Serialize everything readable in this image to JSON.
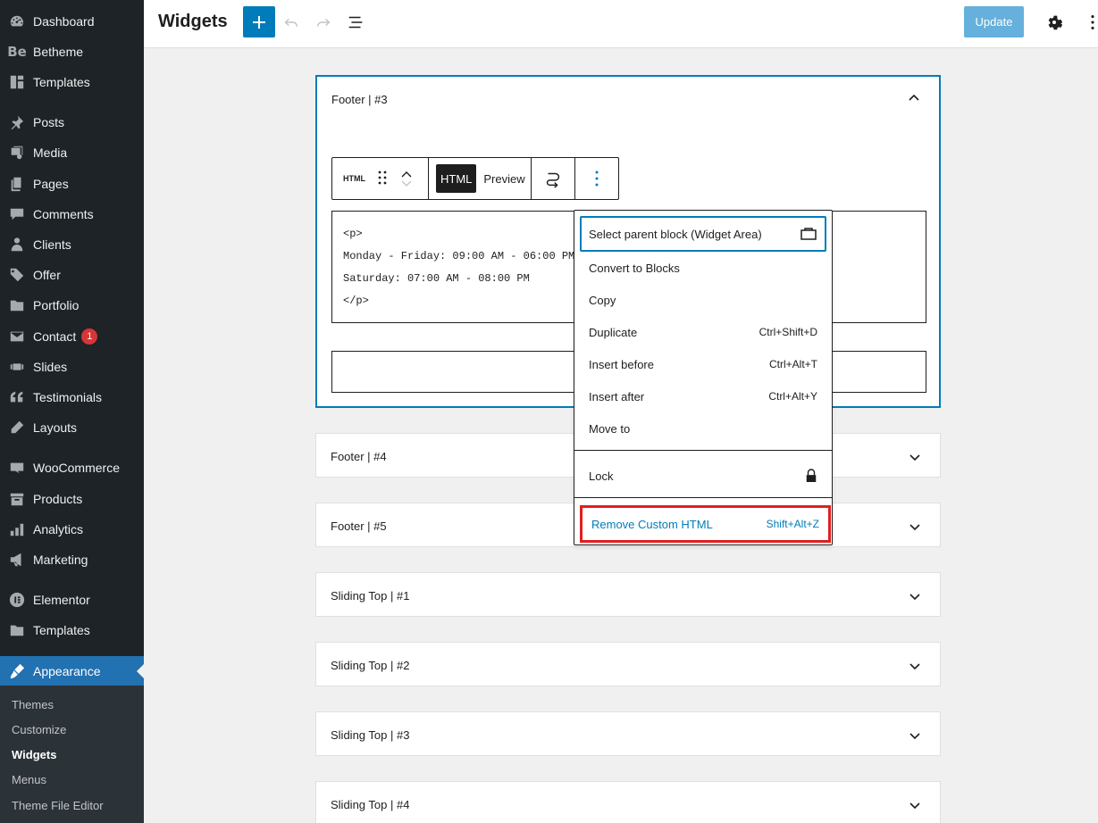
{
  "sidebar": {
    "items": [
      {
        "label": "Dashboard",
        "icon": "dashboard-icon"
      },
      {
        "label": "Betheme",
        "icon": "betheme-icon"
      },
      {
        "label": "Templates",
        "icon": "templates-icon"
      },
      {
        "label": "Posts",
        "icon": "pin-icon"
      },
      {
        "label": "Media",
        "icon": "media-icon"
      },
      {
        "label": "Pages",
        "icon": "pages-icon"
      },
      {
        "label": "Comments",
        "icon": "comments-icon"
      },
      {
        "label": "Clients",
        "icon": "clients-icon"
      },
      {
        "label": "Offer",
        "icon": "tag-icon"
      },
      {
        "label": "Portfolio",
        "icon": "folder-icon"
      },
      {
        "label": "Contact",
        "icon": "mail-icon",
        "badge": "1"
      },
      {
        "label": "Slides",
        "icon": "slides-icon"
      },
      {
        "label": "Testimonials",
        "icon": "quote-icon"
      },
      {
        "label": "Layouts",
        "icon": "pencil-icon"
      },
      {
        "label": "WooCommerce",
        "icon": "woocommerce-icon"
      },
      {
        "label": "Products",
        "icon": "archive-icon"
      },
      {
        "label": "Analytics",
        "icon": "chart-icon"
      },
      {
        "label": "Marketing",
        "icon": "megaphone-icon"
      },
      {
        "label": "Elementor",
        "icon": "elementor-icon"
      },
      {
        "label": "Templates",
        "icon": "folder-icon"
      },
      {
        "label": "Appearance",
        "icon": "brush-icon"
      }
    ],
    "submenu": [
      "Themes",
      "Customize",
      "Widgets",
      "Menus",
      "Theme File Editor"
    ],
    "submenu_current": "Widgets"
  },
  "topbar": {
    "title": "Widgets",
    "update_label": "Update"
  },
  "open_panel": {
    "title": "Footer | #3",
    "toolbar": {
      "block_type": "HTML",
      "html_tab": "HTML",
      "preview_tab": "Preview"
    },
    "code": [
      "<p>",
      "Monday - Friday: 09:00 AM - 06:00 PM<",
      "Saturday: 07:00 AM - 08:00 PM",
      "</p>"
    ]
  },
  "dropdown": {
    "select_parent": "Select parent block (Widget Area)",
    "items": [
      {
        "label": "Convert to Blocks",
        "shortcut": ""
      },
      {
        "label": "Copy",
        "shortcut": ""
      },
      {
        "label": "Duplicate",
        "shortcut": "Ctrl+Shift+D"
      },
      {
        "label": "Insert before",
        "shortcut": "Ctrl+Alt+T"
      },
      {
        "label": "Insert after",
        "shortcut": "Ctrl+Alt+Y"
      },
      {
        "label": "Move to",
        "shortcut": ""
      }
    ],
    "lock": "Lock",
    "remove": {
      "label": "Remove Custom HTML",
      "shortcut": "Shift+Alt+Z"
    }
  },
  "panels": [
    "Footer | #4",
    "Footer | #5",
    "Sliding Top | #1",
    "Sliding Top | #2",
    "Sliding Top | #3",
    "Sliding Top | #4"
  ],
  "colors": {
    "sidebar_bg": "#1d2327",
    "accent": "#007cba",
    "active_menu": "#2271b1",
    "highlight_border": "#e21f1f"
  }
}
